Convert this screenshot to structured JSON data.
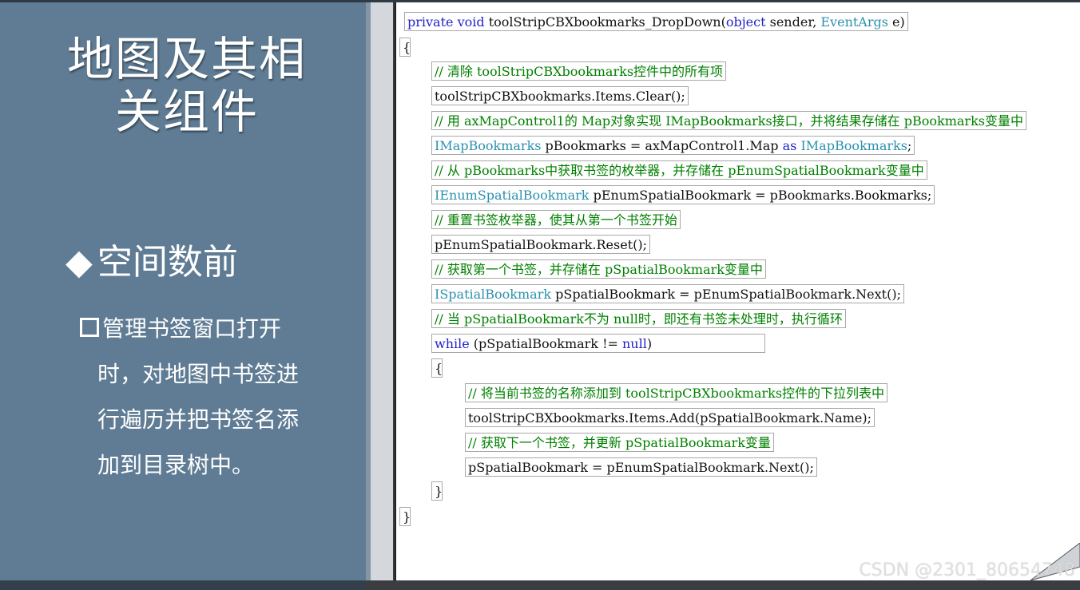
{
  "slide": {
    "title_line1": "地图及其相",
    "title_line2": "关组件",
    "section_marker": "◆",
    "section_title": "空间数前",
    "bullet_lines": [
      "管理书签窗口打开",
      "时，对地图中书签进",
      "行遍历并把书签名添",
      "加到目录树中。"
    ]
  },
  "code": {
    "l1_kw1": "private",
    "l1_kw2": "void",
    "l1_name": " toolStripCBXbookmarks_DropDown(",
    "l1_kw3": "object",
    "l1_mid": " sender, ",
    "l1_type": "EventArgs",
    "l1_end": " e)",
    "open_brace": "{",
    "close_brace": "}",
    "c1": "// 清除 toolStripCBXbookmarks控件中的所有项",
    "s1": "toolStripCBXbookmarks.Items.Clear();",
    "c2": "// 用 axMapControl1的 Map对象实现 IMapBookmarks接口，并将结果存储在 pBookmarks变量中",
    "s2_type": "IMapBookmarks",
    "s2_mid": " pBookmarks = axMapControl1.Map ",
    "s2_kw": "as",
    "s2_sp": " ",
    "s2_type2": "IMapBookmarks",
    "s2_end": ";",
    "c3": "// 从 pBookmarks中获取书签的枚举器，并存储在 pEnumSpatialBookmark变量中",
    "s3_type": "IEnumSpatialBookmark",
    "s3_rest": " pEnumSpatialBookmark = pBookmarks.Bookmarks;",
    "c4": "// 重置书签枚举器，使其从第一个书签开始",
    "s4": "pEnumSpatialBookmark.Reset();",
    "c5": "// 获取第一个书签，并存储在 pSpatialBookmark变量中",
    "s5_type": "ISpatialBookmark",
    "s5_rest": " pSpatialBookmark = pEnumSpatialBookmark.Next();",
    "c6": "// 当 pSpatialBookmark不为 null时，即还有书签未处理时，执行循环",
    "s6_kw": "while",
    "s6_mid": " (pSpatialBookmark != ",
    "s6_kw2": "null",
    "s6_end": ")",
    "c7": "// 将当前书签的名称添加到 toolStripCBXbookmarks控件的下拉列表中",
    "s7": "toolStripCBXbookmarks.Items.Add(pSpatialBookmark.Name);",
    "c8": "// 获取下一个书签，并更新 pSpatialBookmark变量",
    "s8": "pSpatialBookmark = pEnumSpatialBookmark.Next();"
  },
  "watermark": "CSDN @2301_80654748",
  "colors": {
    "left_panel": "#5f7c94",
    "keyword": "#2222cc",
    "type": "#2b91af",
    "comment": "#008000"
  }
}
